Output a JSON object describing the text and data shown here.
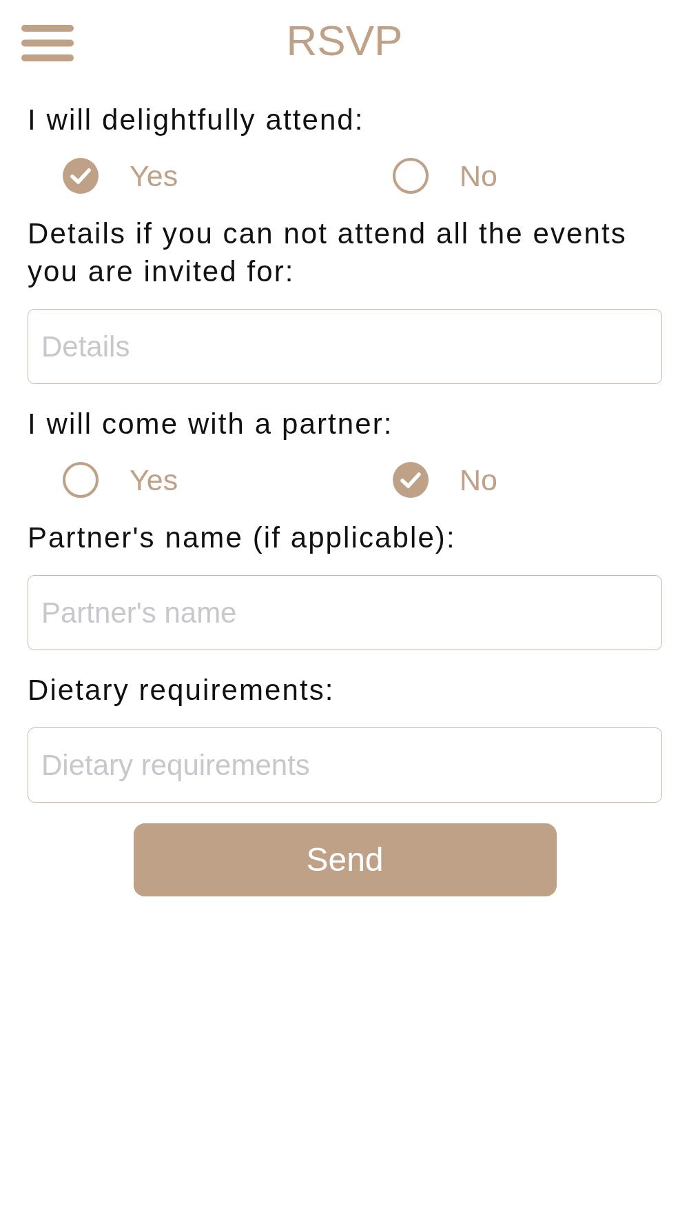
{
  "header": {
    "title": "RSVP"
  },
  "fields": [
    {
      "kind": "radio",
      "label": "I will delightfully attend:",
      "options": [
        {
          "label": "Yes",
          "selected": true
        },
        {
          "label": "No",
          "selected": false
        }
      ]
    },
    {
      "kind": "text",
      "label": "Details if you can not attend all the events you are invited for:",
      "placeholder": "Details"
    },
    {
      "kind": "radio",
      "label": "I will come with a partner:",
      "options": [
        {
          "label": "Yes",
          "selected": false
        },
        {
          "label": "No",
          "selected": true
        }
      ]
    },
    {
      "kind": "text",
      "label": "Partner's name (if applicable):",
      "placeholder": "Partner's name"
    },
    {
      "kind": "text",
      "label": "Dietary requirements:",
      "placeholder": "Dietary requirements"
    }
  ],
  "send_button": {
    "label": "Send"
  }
}
